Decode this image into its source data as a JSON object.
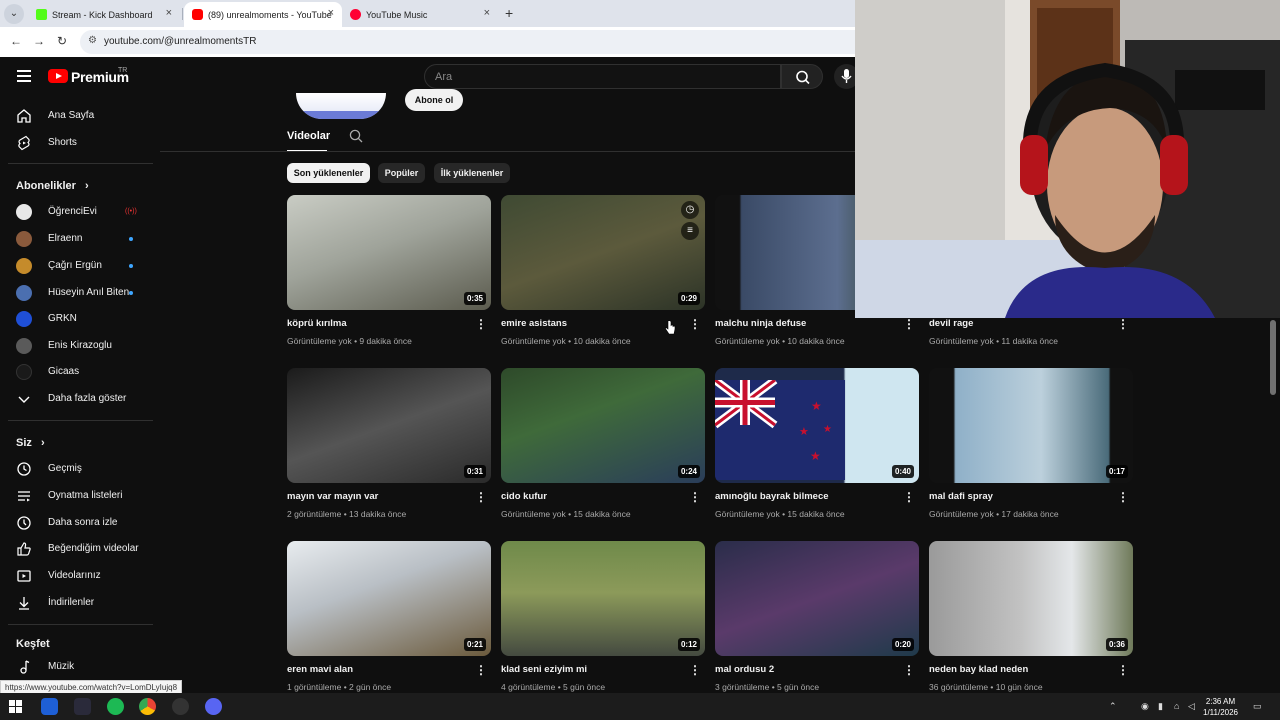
{
  "browser": {
    "tabs": [
      {
        "title": "Stream - Kick Dashboard",
        "close": "×",
        "favicon_color": "#53fc18"
      },
      {
        "title": "(89) unrealmoments - YouTube",
        "close": "×",
        "favicon_color": "#ff0000"
      },
      {
        "title": "YouTube Music",
        "close": "×",
        "favicon_color": "#ff0033"
      }
    ],
    "new_tab": "+",
    "url": "youtube.com/@unrealmomentsTR"
  },
  "masthead": {
    "brand": "Premium",
    "region": "TR",
    "search_placeholder": "Ara"
  },
  "sidebar": {
    "main": [
      {
        "label": "Ana Sayfa",
        "icon": "home-icon"
      },
      {
        "label": "Shorts",
        "icon": "shorts-icon"
      }
    ],
    "subscriptions_header": "Abonelikler",
    "chevron": "›",
    "subscriptions": [
      {
        "label": "ÖğrenciEvi",
        "color": "#e8e8e8",
        "indicator": "live"
      },
      {
        "label": "Elraenn",
        "color": "#8a5a3c",
        "indicator": "dot"
      },
      {
        "label": "Çağrı Ergün",
        "color": "#c58b2b",
        "indicator": "dot"
      },
      {
        "label": "Hüseyin Anıl Biten",
        "color": "#4b6fb0",
        "indicator": "dot"
      },
      {
        "label": "GRKN",
        "color": "#1f4fd6",
        "indicator": ""
      },
      {
        "label": "Enis Kirazoglu",
        "color": "#5a5a5a",
        "indicator": ""
      },
      {
        "label": "Gicaas",
        "color": "#1a1a1a",
        "indicator": ""
      }
    ],
    "show_more": "Daha fazla göster",
    "you_header": "Siz",
    "you": [
      {
        "label": "Geçmiş",
        "icon": "history-icon"
      },
      {
        "label": "Oynatma listeleri",
        "icon": "playlists-icon"
      },
      {
        "label": "Daha sonra izle",
        "icon": "watch-later-icon"
      },
      {
        "label": "Beğendiğim videolar",
        "icon": "like-icon"
      },
      {
        "label": "Videolarınız",
        "icon": "your-videos-icon"
      },
      {
        "label": "İndirilenler",
        "icon": "downloads-icon"
      }
    ],
    "explore_header": "Keşfet",
    "explore": [
      {
        "label": "Müzik",
        "icon": "music-icon"
      }
    ]
  },
  "channel": {
    "subscribe": "Abone ol",
    "tab": "Videolar",
    "chips": [
      "Son yüklenenler",
      "Popüler",
      "İlk yüklenenler"
    ]
  },
  "videos": [
    {
      "title": "köprü kırılma",
      "meta": "Görüntüleme yok • 9 dakika önce",
      "duration": "0:35",
      "bg": "linear-gradient(160deg,#c9ccc4 0%,#9fa39a 45%,#5b5b4e 100%)"
    },
    {
      "title": "emire asistans",
      "meta": "Görüntüleme yok • 10 dakika önce",
      "duration": "0:29",
      "bg": "linear-gradient(160deg,#3f4a33 0%,#5c5a3c 50%,#2c3327 100%)"
    },
    {
      "title": "malchu ninja defuse",
      "meta": "Görüntüleme yok • 10 dakika önce",
      "duration": "",
      "bg": "linear-gradient(90deg,#111 0%,#111 12%,#3a4a66 13%,#5c6e8f 60%,#2e3f2a 88%,#111 89%)"
    },
    {
      "title": "devil rage",
      "meta": "Görüntüleme yok • 11 dakika önce",
      "duration": "",
      "bg": "#1a1a1a"
    },
    {
      "title": "mayın var mayın var",
      "meta": "2 görüntüleme • 13 dakika önce",
      "duration": "0:31",
      "bg": "linear-gradient(160deg,#1b1b1b 0%,#555 50%,#2a2a2a 100%)"
    },
    {
      "title": "cido kufur",
      "meta": "Görüntüleme yok • 15 dakika önce",
      "duration": "0:24",
      "bg": "linear-gradient(160deg,#2e4a2a 0%,#3f6a3a 40%,#2a3d5a 100%)"
    },
    {
      "title": "amınoğlu bayrak bilmece",
      "meta": "Görüntüleme yok • 15 dakika önce",
      "duration": "0:40",
      "bg": "linear-gradient(90deg,#1e2a4a 0%,#1e2a4a 63%,#cfe6f0 64%,#cfe6f0 100%)"
    },
    {
      "title": "mal dafi spray",
      "meta": "Görüntüleme yok • 17 dakika önce",
      "duration": "0:17",
      "bg": "linear-gradient(90deg,#111 0%,#111 12%,#8fb0c8 13%,#bcd0dc 55%,#4a6b7a 88%,#111 89%)"
    },
    {
      "title": "eren mavi alan",
      "meta": "1 görüntüleme • 2 gün önce",
      "duration": "0:21",
      "bg": "linear-gradient(160deg,#e8ecef 0%,#b9bfc5 40%,#6b5a3c 100%)"
    },
    {
      "title": "klad seni eziyim mi",
      "meta": "4 görüntüleme • 5 gün önce",
      "duration": "0:12",
      "bg": "linear-gradient(180deg,#6f8a4a 0%,#8c9a5a 45%,#444a40 100%)"
    },
    {
      "title": "mal ordusu 2",
      "meta": "3 görüntüleme • 5 gün önce",
      "duration": "0:20",
      "bg": "linear-gradient(160deg,#2a2d4a 0%,#5a3a6a 50%,#1f3a4a 100%)"
    },
    {
      "title": "neden bay klad neden",
      "meta": "36 görüntüleme • 10 gün önce",
      "duration": "0:36",
      "bg": "linear-gradient(90deg,#9a9a9a 0%,#c2c2c2 45%,#e4e7e9 70%,#6f7a5a 100%)"
    }
  ],
  "hover": {
    "watch_later": "◷",
    "queue": "≡"
  },
  "status_url": "https://www.youtube.com/watch?v=LomDLyIujq8",
  "taskbar": {
    "time": "2:36 AM",
    "date": "1/11/2026"
  }
}
